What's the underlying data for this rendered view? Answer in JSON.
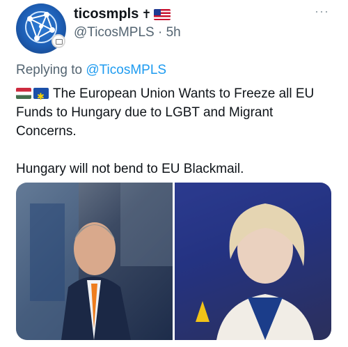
{
  "tweet": {
    "display_name": "ticosmpls",
    "name_emoji": [
      "cross",
      "us-flag"
    ],
    "handle": "@TicosMPLS",
    "time": "5h",
    "separator": "·",
    "more": "···",
    "replying_prefix": "Replying to",
    "replying_handle": "@TicosMPLS",
    "text_flags": [
      "hungary-flag",
      "eu-flag"
    ],
    "text_line1": "The European Union Wants to Freeze all EU Funds to Hungary due to LGBT and Migrant Concerns.",
    "text_line2": "Hungary will not bend to EU Blackmail."
  },
  "media": {
    "images": [
      {
        "subject": "man-in-suit-orange-tie"
      },
      {
        "subject": "woman-blonde-hair-blue-background"
      }
    ]
  }
}
